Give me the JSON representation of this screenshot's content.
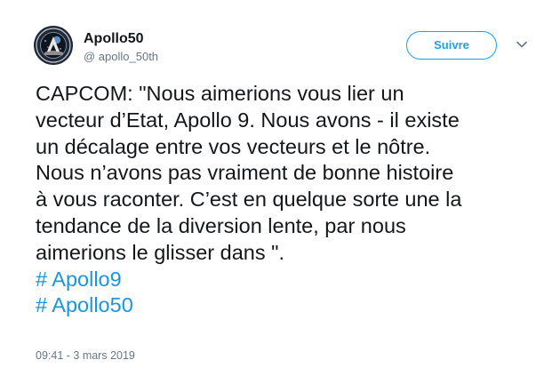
{
  "author": {
    "display_name": "Apollo50",
    "handle": "@ apollo_50th",
    "avatar_icon": "apollo-mission-patch-icon"
  },
  "actions": {
    "follow_label": "Suivre",
    "menu_icon": "chevron-down-icon"
  },
  "tweet": {
    "lines": [
      "CAPCOM: \"Nous aimerions vous lier un",
      "vecteur d’Etat, Apollo 9. Nous avons - il existe",
      "un décalage entre vos vecteurs et le nôtre.",
      "Nous n’avons pas vraiment de bonne histoire",
      "à vous raconter. C’est en quelque sorte une la",
      "tendance de la diversion lente, par nous",
      "aimerions le glisser dans \"."
    ],
    "hashtags": [
      "# Apollo9",
      "# Apollo50"
    ],
    "timestamp": "09:41 - 3 mars 2019"
  },
  "colors": {
    "accent": "#1da1f2",
    "hashtag": "#1b95e0",
    "text": "#14171a",
    "muted": "#657786"
  }
}
